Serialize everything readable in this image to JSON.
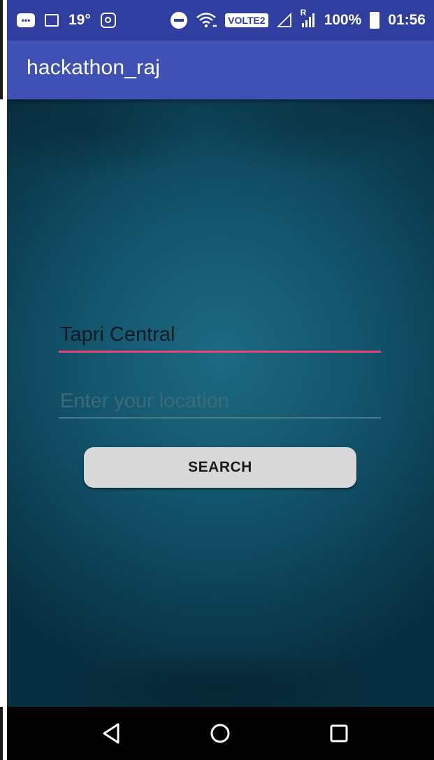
{
  "status_bar": {
    "temperature": "19°",
    "network_badge": "VOLTE2",
    "roaming_label": "R",
    "battery_percent": "100%",
    "time": "01:56",
    "icons": [
      "chat-icon",
      "gallery-icon",
      "instagram-icon",
      "do-not-disturb-icon",
      "wifi-icon",
      "signal-icon",
      "battery-icon"
    ]
  },
  "app_bar": {
    "title": "hackathon_raj"
  },
  "form": {
    "name_value": "Tapri Central",
    "name_placeholder": "",
    "location_value": "",
    "location_placeholder": "Enter your location",
    "search_label": "SEARCH"
  },
  "nav_bar": {
    "icons": [
      "back-icon",
      "home-icon",
      "recents-icon"
    ]
  },
  "colors": {
    "status_bar": "#303f9f",
    "app_bar": "#3f51b5",
    "accent": "#e0457c",
    "background": "#12546c",
    "button": "#d8d8d8"
  }
}
